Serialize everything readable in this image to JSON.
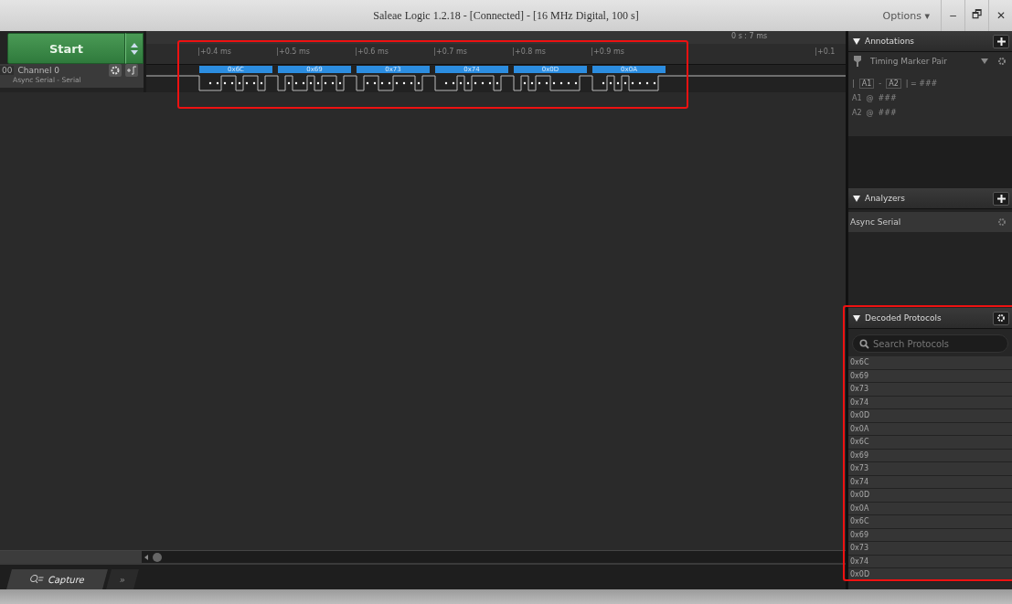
{
  "window": {
    "title": "Saleae Logic 1.2.18 - [Connected] - [16 MHz Digital, 100 s]",
    "options": "Options ▾",
    "controls": [
      "–",
      "🗗",
      "✕"
    ]
  },
  "start_button": {
    "label": "Start"
  },
  "channels": [
    {
      "number": "00",
      "name": "Channel 0",
      "analyzer": "Async Serial - Serial"
    }
  ],
  "timeline": {
    "cursor": "0 s : 7 ms",
    "ticks": [
      "+0.4 ms",
      "+0.5 ms",
      "+0.6 ms",
      "+0.7 ms",
      "+0.8 ms",
      "+0.9 ms"
    ],
    "edge_tick": "+0.1"
  },
  "frames": [
    "0x6C",
    "0x69",
    "0x73",
    "0x74",
    "0x0D",
    "0x0A"
  ],
  "bottom_tabs": [
    {
      "label": "Capture",
      "selected": true
    },
    {
      "label": "»",
      "selected": false
    }
  ],
  "annotations": {
    "title": "Annotations",
    "marker": "Timing Marker Pair",
    "lines": [
      {
        "kind": "diff",
        "open": "|",
        "a": "A1",
        "b": "A2",
        "sep": "-",
        "value": "| = ###"
      },
      {
        "kind": "at",
        "a": "A1",
        "value": "###"
      },
      {
        "kind": "at",
        "a": "A2",
        "value": "###"
      }
    ],
    "at": "@"
  },
  "analyzers": {
    "title": "Analyzers",
    "items": [
      "Async Serial"
    ]
  },
  "decoded": {
    "title": "Decoded Protocols",
    "placeholder": "Search Protocols",
    "rows": [
      "0x6C",
      "0x69",
      "0x73",
      "0x74",
      "0x0D",
      "0x0A",
      "0x6C",
      "0x69",
      "0x73",
      "0x74",
      "0x0D",
      "0x0A",
      "0x6C",
      "0x69",
      "0x73",
      "0x74",
      "0x0D"
    ]
  }
}
